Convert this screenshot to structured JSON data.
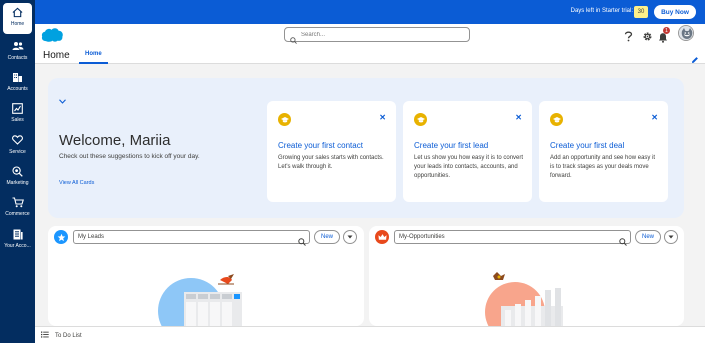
{
  "nav": {
    "items": [
      {
        "label": "Home",
        "icon": "home-icon"
      },
      {
        "label": "Contacts",
        "icon": "contacts-icon"
      },
      {
        "label": "Accounts",
        "icon": "accounts-icon"
      },
      {
        "label": "Sales",
        "icon": "sales-icon"
      },
      {
        "label": "Service",
        "icon": "service-icon"
      },
      {
        "label": "Marketing",
        "icon": "marketing-icon"
      },
      {
        "label": "Commerce",
        "icon": "commerce-icon"
      },
      {
        "label": "Your Acco...",
        "icon": "your-account-icon"
      }
    ]
  },
  "trial": {
    "text": "Days left in Starter trial:",
    "days": "30",
    "buy_label": "Buy Now"
  },
  "header": {
    "search_placeholder": "Search...",
    "notification_count": "1"
  },
  "app": {
    "name": "Home",
    "tab": "Home"
  },
  "welcome": {
    "title": "Welcome, Mariia",
    "subtitle": "Check out these suggestions to kick off your day.",
    "view_all": "View All Cards",
    "cards": [
      {
        "title": "Create your first contact",
        "body": "Growing your sales starts with contacts. Let's walk through it."
      },
      {
        "title": "Create your first lead",
        "body": "Let us show you how easy it is to convert your leads into contacts, accounts, and opportunities."
      },
      {
        "title": "Create your first deal",
        "body": "Add an opportunity and see how easy it is to track stages as your deals move forward."
      }
    ]
  },
  "lists": {
    "leads": {
      "view": "My Leads",
      "new_label": "New"
    },
    "opportunities": {
      "view": "My-Opportunities",
      "new_label": "New"
    }
  },
  "utility": {
    "todo_label": "To Do List"
  },
  "colors": {
    "brand_blue": "#0b5cd5",
    "nav_dark": "#032d60",
    "leads_icon": "#1b96ff",
    "opps_icon": "#e8491c",
    "suggestion_icon": "#e8b200"
  }
}
